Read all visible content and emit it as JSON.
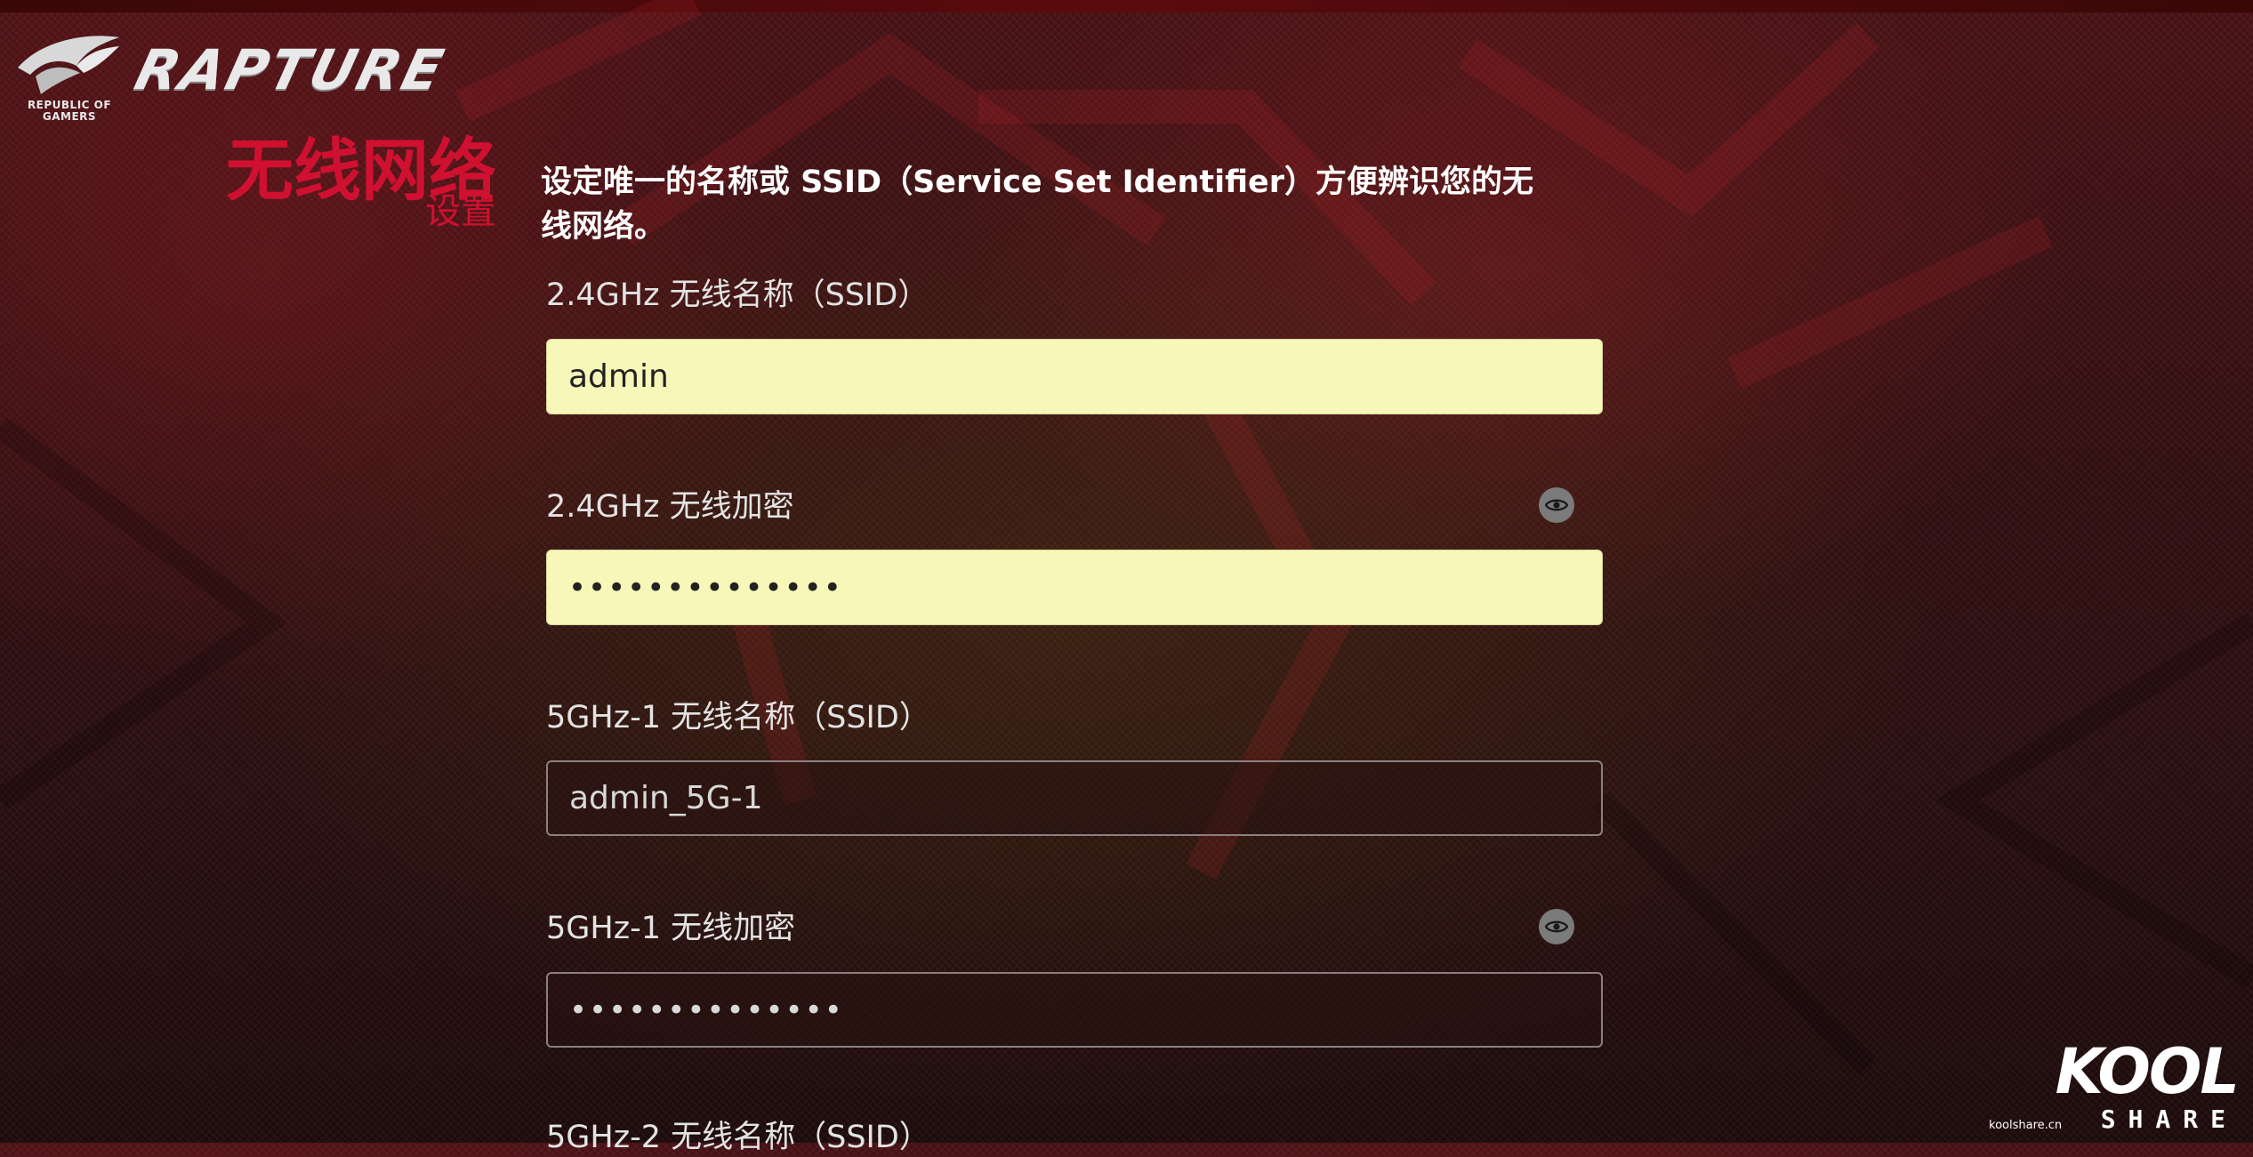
{
  "brand": {
    "name": "RAPTURE",
    "sub_line1": "REPUBLIC OF",
    "sub_line2": "GAMERS"
  },
  "page": {
    "title": "无线网络",
    "subtitle": "设置",
    "intro": "设定唯一的名称或 SSID（Service Set Identifier）方便辨识您的无线网络。"
  },
  "form": {
    "ssid_24": {
      "label": "2.4GHz 无线名称（SSID）",
      "value": "admin"
    },
    "key_24": {
      "label": "2.4GHz 无线加密",
      "value": "••••••••••••••"
    },
    "ssid_5g1": {
      "label": "5GHz-1 无线名称（SSID）",
      "value": "admin_5G-1"
    },
    "key_5g1": {
      "label": "5GHz-1 无线加密",
      "value": "••••••••••••••"
    },
    "ssid_5g2": {
      "label": "5GHz-2 无线名称（SSID）"
    }
  },
  "watermark": {
    "word": "KOOL",
    "share": "SHARE",
    "domain": "koolshare.cn"
  },
  "colors": {
    "accent": "#d01030",
    "field_filled": "#f6f7b8",
    "background": "#2a0d0f"
  },
  "icons": [
    "rog-eye-logo-icon",
    "password-visibility-icon"
  ]
}
